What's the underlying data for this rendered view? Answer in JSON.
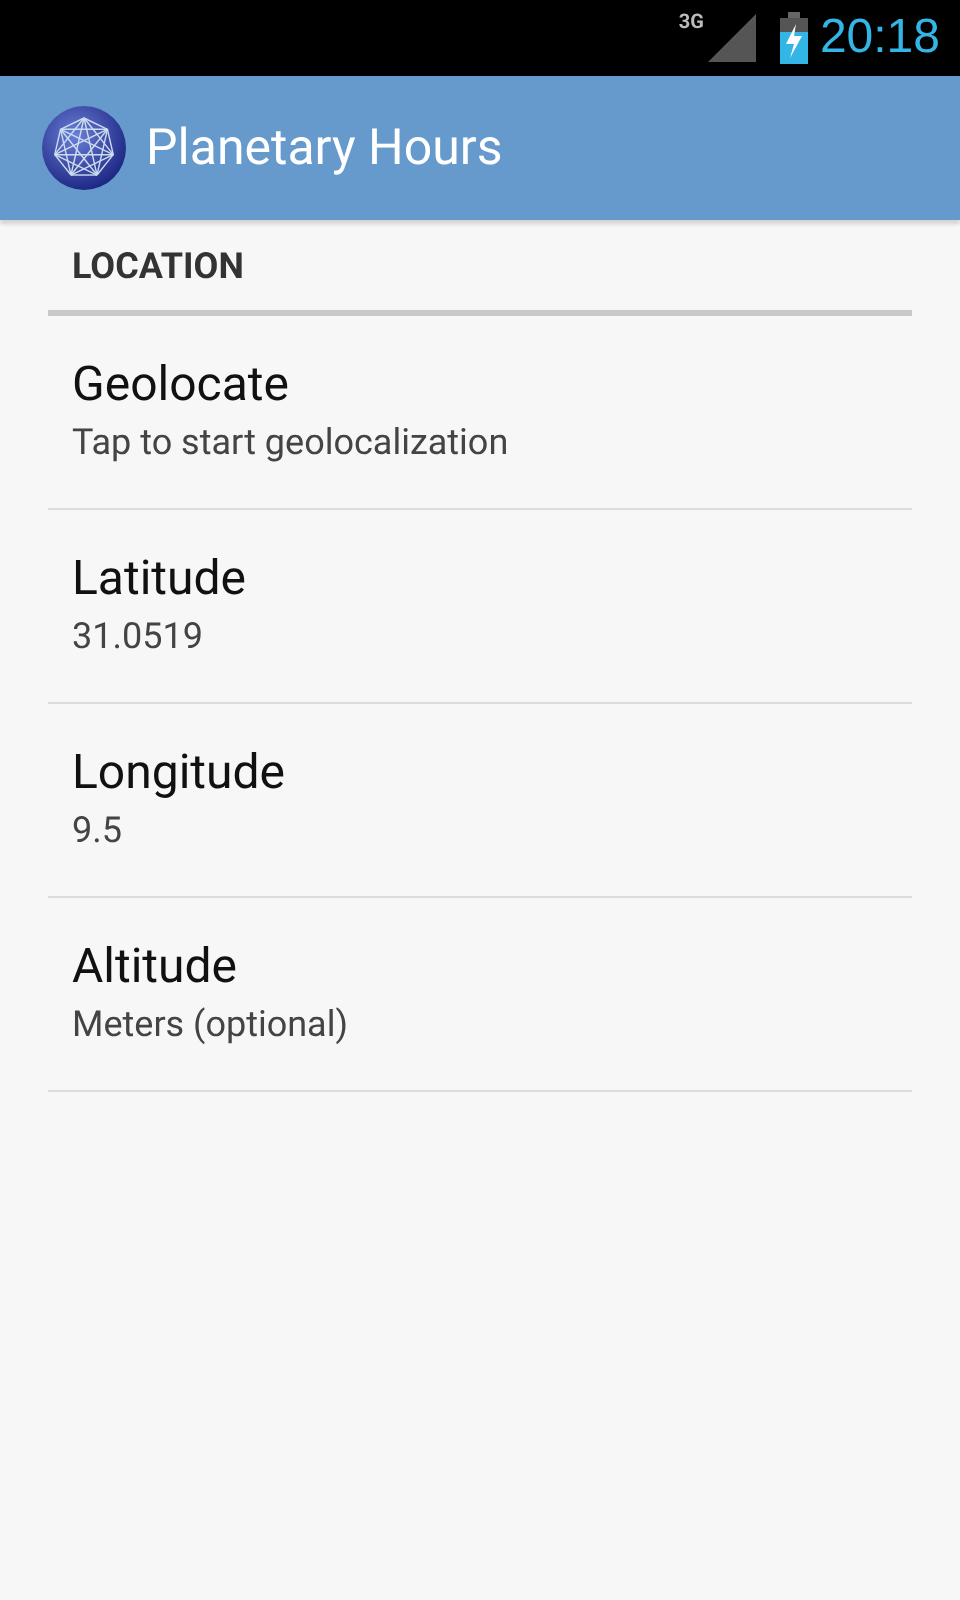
{
  "status_bar": {
    "network": "3G",
    "time": "20:18"
  },
  "action_bar": {
    "title": "Planetary Hours"
  },
  "category": {
    "title": "LOCATION"
  },
  "preferences": [
    {
      "title": "Geolocate",
      "summary": "Tap to start geolocalization"
    },
    {
      "title": "Latitude",
      "summary": "31.0519"
    },
    {
      "title": "Longitude",
      "summary": "9.5"
    },
    {
      "title": "Altitude",
      "summary": "Meters (optional)"
    }
  ]
}
